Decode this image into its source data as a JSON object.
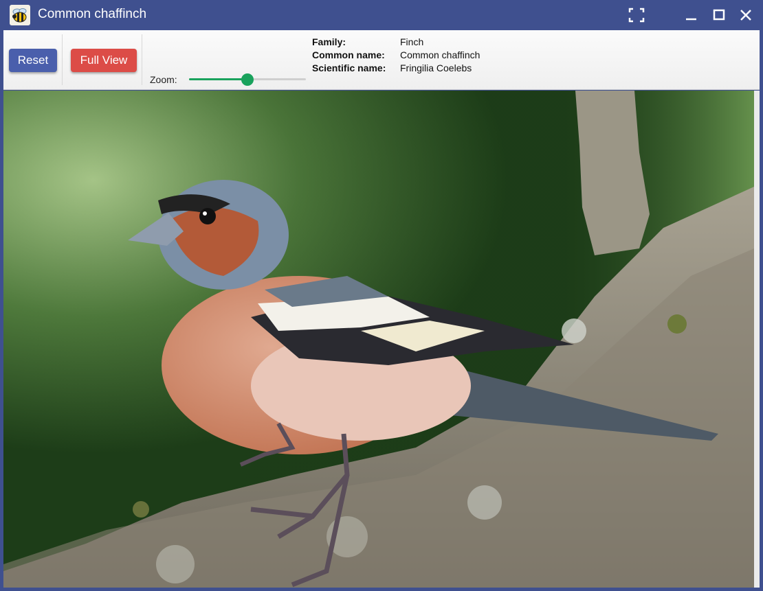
{
  "window": {
    "title": "Common chaffinch",
    "app_icon": "bee-icon",
    "controls": [
      "fullscreen-icon",
      "minimize-icon",
      "maximize-icon",
      "close-icon"
    ]
  },
  "toolbar": {
    "reset_label": "Reset",
    "full_view_label": "Full View",
    "zoom_label": "Zoom:",
    "zoom_value": 0.5,
    "colors": {
      "reset": "#4a5fac",
      "full_view": "#dc4c47",
      "slider": "#19a25c",
      "titlebar": "#3f508f"
    }
  },
  "info": [
    {
      "key": "Family:",
      "value": "Finch"
    },
    {
      "key": "Common name:",
      "value": "Common chaffinch"
    },
    {
      "key": "Scientific name:",
      "value": "Fringilia Coelebs"
    }
  ]
}
